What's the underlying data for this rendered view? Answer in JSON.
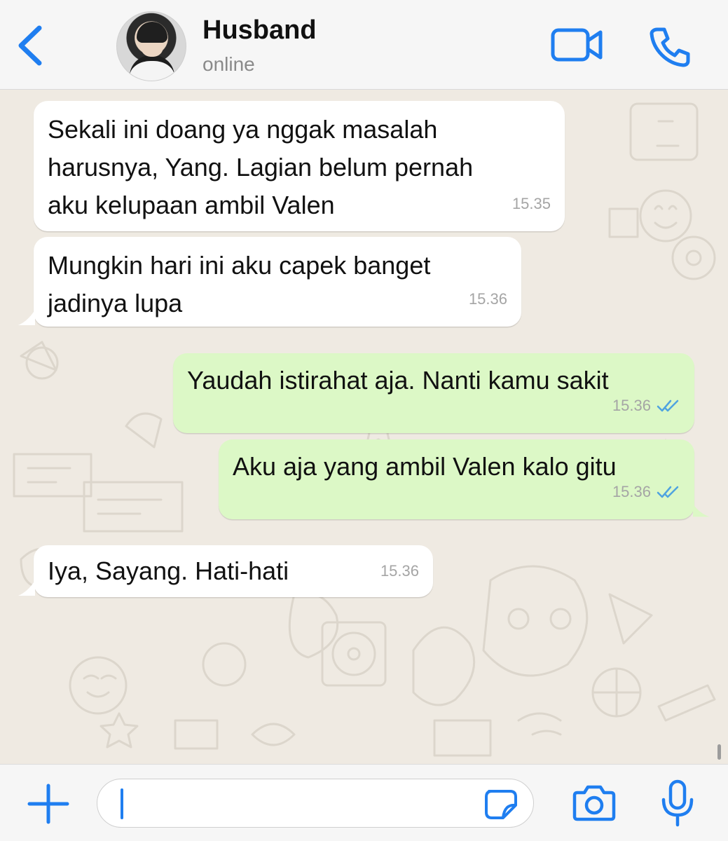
{
  "header": {
    "contact_name": "Husband",
    "status": "online",
    "accent_color": "#1f7ef0"
  },
  "icons": {
    "back": "chevron-left-icon",
    "video": "video-camera-icon",
    "phone": "phone-icon",
    "plus": "plus-icon",
    "sticker": "sticker-icon",
    "camera": "camera-icon",
    "mic": "microphone-icon"
  },
  "messages": [
    {
      "direction": "incoming",
      "text": "Sekali ini doang ya nggak masalah\nharusnya, Yang. Lagian belum pernah\naku kelupaan ambil Valen",
      "time": "15.35"
    },
    {
      "direction": "incoming",
      "text": "Mungkin hari ini aku capek banget\njadinya lupa",
      "time": "15.36"
    },
    {
      "direction": "outgoing",
      "text": "Yaudah istirahat aja. Nanti kamu sakit",
      "time": "15.36",
      "read": true
    },
    {
      "direction": "outgoing",
      "text": "Aku aja yang ambil Valen kalo gitu",
      "time": "15.36",
      "read": true
    },
    {
      "direction": "incoming",
      "text": "Iya, Sayang. Hati-hati",
      "time": "15.36"
    }
  ],
  "composer": {
    "value": "",
    "placeholder": ""
  },
  "colors": {
    "incoming_bubble": "#ffffff",
    "outgoing_bubble": "#dcf8c6",
    "wallpaper": "#efeae2",
    "read_ticks": "#4fa3e0"
  }
}
